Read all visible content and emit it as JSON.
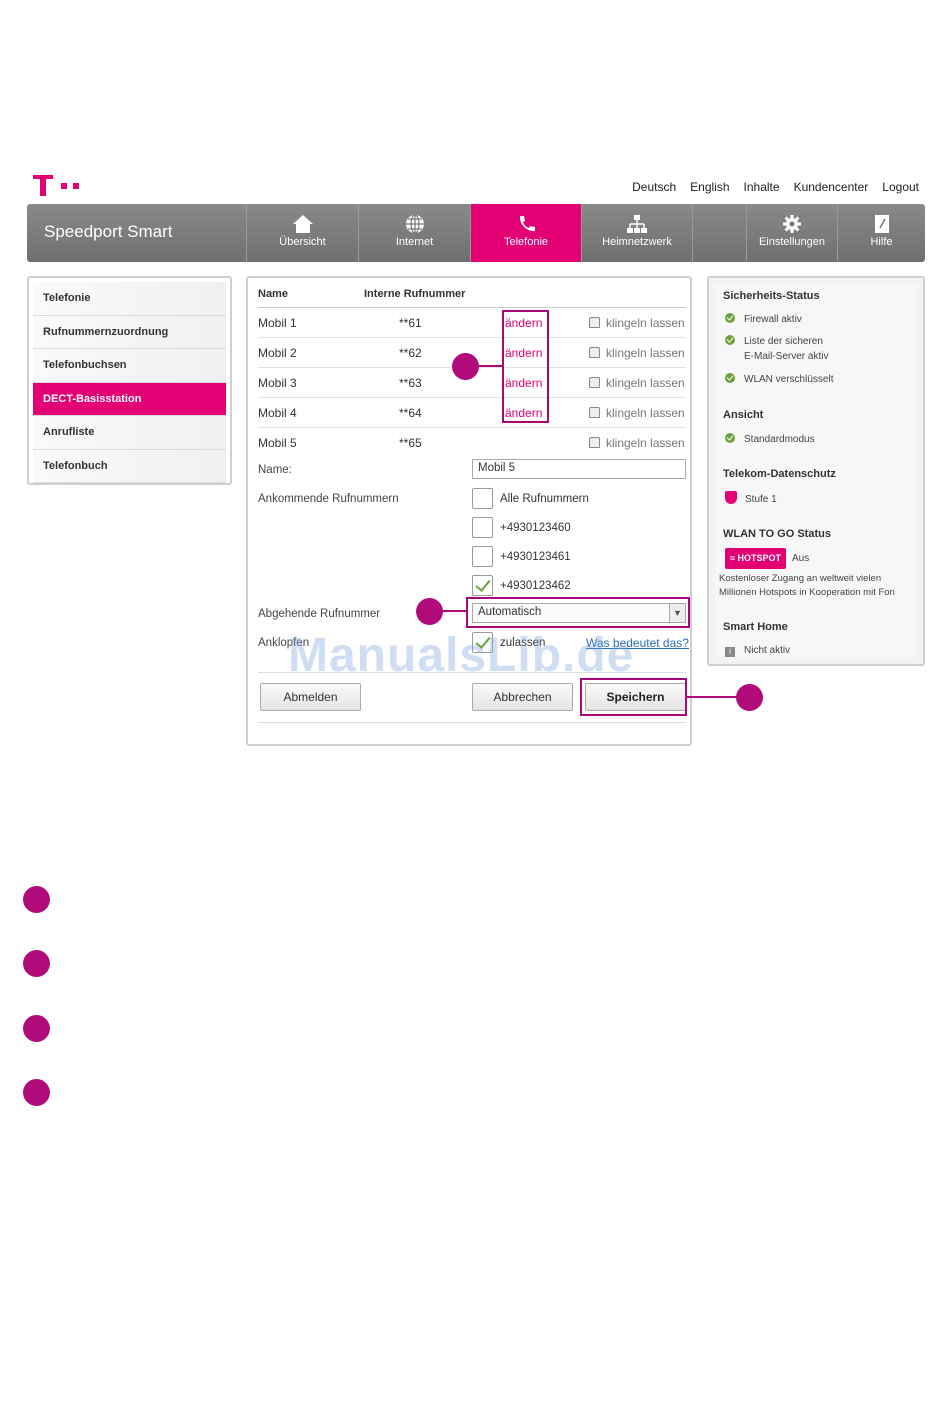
{
  "top_links": [
    "Deutsch",
    "English",
    "Inhalte",
    "Kundencenter",
    "Logout"
  ],
  "brand": "Speedport Smart",
  "nav": [
    {
      "label": "Übersicht",
      "icon": "home-icon"
    },
    {
      "label": "Internet",
      "icon": "globe-icon"
    },
    {
      "label": "Telefonie",
      "icon": "phone-icon",
      "active": true
    },
    {
      "label": "Heimnetzwerk",
      "icon": "network-icon"
    },
    {
      "label": "Einstellungen",
      "icon": "gear-icon"
    },
    {
      "label": "Hilfe",
      "icon": "help-book-icon"
    }
  ],
  "sidebar": [
    "Telefonie",
    "Rufnummernzuordnung",
    "Telefonbuchsen",
    "DECT-Basisstation",
    "Anrufliste",
    "Telefonbuch"
  ],
  "table": {
    "col_name": "Name",
    "col_number": "Interne Rufnummer",
    "rows": [
      {
        "name": "Mobil 1",
        "number": "**61",
        "action": "ändern",
        "ring": "klingeln lassen"
      },
      {
        "name": "Mobil 2",
        "number": "**62",
        "action": "ändern",
        "ring": "klingeln lassen"
      },
      {
        "name": "Mobil 3",
        "number": "**63",
        "action": "ändern",
        "ring": "klingeln lassen"
      },
      {
        "name": "Mobil 4",
        "number": "**64",
        "action": "ändern",
        "ring": "klingeln lassen"
      },
      {
        "name": "Mobil 5",
        "number": "**65",
        "action": "",
        "ring": "klingeln lassen"
      }
    ]
  },
  "form": {
    "name_label": "Name:",
    "name_value": "Mobil 5",
    "incoming_label": "Ankommende Rufnummern",
    "incoming": [
      {
        "label": "Alle Rufnummern",
        "checked": false
      },
      {
        "label": "+4930123460",
        "checked": false
      },
      {
        "label": "+4930123461",
        "checked": false
      },
      {
        "label": "+4930123462",
        "checked": true
      }
    ],
    "outgoing_label": "Abgehende Rufnummer",
    "outgoing_value": "Automatisch",
    "knock_label": "Anklopfen",
    "knock_option": "zulassen",
    "knock_checked": true,
    "help_link": "Was bedeutet das?"
  },
  "buttons": {
    "logout": "Abmelden",
    "cancel": "Abbrechen",
    "save": "Speichern"
  },
  "status": {
    "security_title": "Sicherheits-Status",
    "security_items": [
      "Firewall aktiv",
      "Liste der sicheren",
      "E-Mail-Server aktiv",
      "WLAN verschlüsselt"
    ],
    "view_title": "Ansicht",
    "view_item": "Standardmodus",
    "privacy_title": "Telekom-Datenschutz",
    "privacy_item": "Stufe 1",
    "wlan_title": "WLAN TO GO Status",
    "hotspot_badge": "HOTSPOT",
    "hotspot_state": "Aus",
    "wlan_desc_1": "Kostenloser Zugang an weltweit vielen",
    "wlan_desc_2": "Millionen Hotspots in Kooperation mit Fon",
    "smarthome_title": "Smart Home",
    "smarthome_item": "Nicht aktiv"
  },
  "watermark": "ManualsLib.de",
  "colors": {
    "accent": "#e20074",
    "marker": "#b10a7a"
  }
}
